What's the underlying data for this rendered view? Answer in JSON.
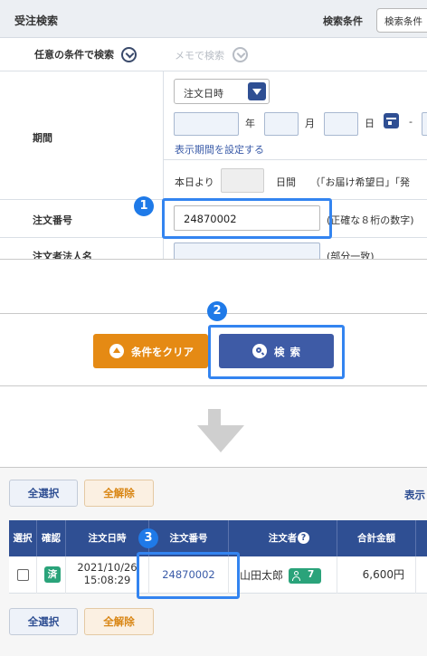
{
  "search_panel": {
    "title": "受注検索",
    "conditions_label": "検索条件",
    "conditions_button": "検索条件",
    "tab_any": "任意の条件で検索",
    "tab_memo": "メモで検索",
    "period_label": "期間",
    "period_select": "注文日時",
    "year": "年",
    "month": "月",
    "day": "日",
    "dash": "-",
    "set_period_link": "表示期間を設定する",
    "from_today": "本日より",
    "days": "日間",
    "delivery_note": "（「お届け希望日」「発",
    "order_number_label": "注文番号",
    "order_number_value": "24870002",
    "order_number_hint": "(正確な８桁の数字)",
    "corp_name_label": "注文者法人名",
    "corp_name_hint": "(部分一致)"
  },
  "buttons_panel": {
    "clear_label": "条件をクリア",
    "search_label": "検索"
  },
  "steps": {
    "step1": "1",
    "step2": "2",
    "step3": "3"
  },
  "results_panel": {
    "select_all": "全選択",
    "deselect_all": "全解除",
    "display_label": "表示",
    "columns": [
      "選択",
      "確認",
      "注文日時",
      "注文番号",
      "注文者",
      "合計金額"
    ],
    "row": {
      "confirm_badge": "済",
      "date": "2021/10/26",
      "time": "15:08:29",
      "order_number": "24870002",
      "customer": "山田太郎",
      "customer_count": "7",
      "total": "6,600円"
    }
  },
  "colors": {
    "primary": "#2f4f93",
    "accent_orange": "#e58a14",
    "highlight": "#3384f0",
    "success": "#2aa37a"
  }
}
